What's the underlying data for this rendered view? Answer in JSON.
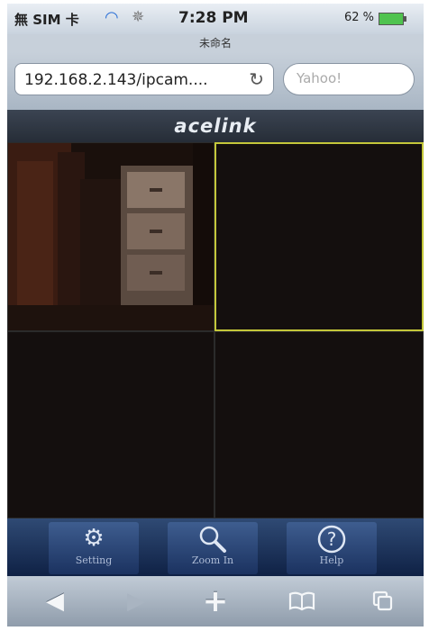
{
  "status_bar": {
    "carrier": "無 SIM 卡",
    "time": "7:28 PM",
    "battery": "62 %"
  },
  "browser": {
    "page_title": "未命名",
    "url": "192.168.2.143/ipcam....",
    "search_placeholder": "Yahoo!"
  },
  "app": {
    "brand": "acelink",
    "cameras": [
      {
        "slot": 1,
        "has_feed": true,
        "selected": false
      },
      {
        "slot": 2,
        "has_feed": false,
        "selected": true
      },
      {
        "slot": 3,
        "has_feed": false,
        "selected": false
      },
      {
        "slot": 4,
        "has_feed": false,
        "selected": false
      }
    ],
    "toolbar": {
      "setting_label": "Setting",
      "zoom_label": "Zoom In",
      "help_label": "Help"
    }
  },
  "icons": {
    "status": [
      "wifi-icon",
      "activity-icon",
      "battery-icon"
    ],
    "address": [
      "reload-icon"
    ],
    "toolbar": [
      "gear-icon",
      "magnifier-icon",
      "question-icon"
    ],
    "safari": [
      "back-arrow-icon",
      "forward-arrow-icon",
      "add-icon",
      "bookmarks-icon",
      "pages-icon"
    ]
  },
  "colors": {
    "selected_border": "#c4c73a",
    "toolbar_blue": "#1b3260"
  }
}
